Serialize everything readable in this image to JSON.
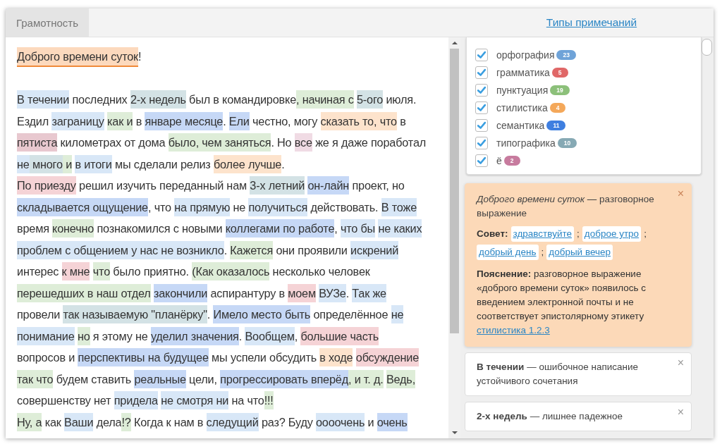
{
  "tabs": [
    {
      "label": "Грамотность",
      "selected": true
    }
  ],
  "types_link": "Типы примечаний",
  "categories": [
    {
      "label": "орфография",
      "count": "23",
      "color": "#6fa3d8",
      "checked": true
    },
    {
      "label": "грамматика",
      "count": "5",
      "color": "#e06868",
      "checked": true
    },
    {
      "label": "пунктуация",
      "count": "19",
      "color": "#8cc07a",
      "checked": true
    },
    {
      "label": "стилистика",
      "count": "4",
      "color": "#f4a85a",
      "checked": true
    },
    {
      "label": "семантика",
      "count": "11",
      "color": "#3f7fe0",
      "checked": true
    },
    {
      "label": "типографика",
      "count": "10",
      "color": "#86a9b4",
      "checked": true
    },
    {
      "label": "ё",
      "count": "2",
      "color": "#c77b9e",
      "checked": true
    }
  ],
  "lines": [
    [
      {
        "t": "Доброго времени суток",
        "color": "#fcd9bd",
        "selected": true
      },
      {
        "t": "!"
      }
    ],
    [
      {
        "t": "В течении",
        "color": "#d8e7f7",
        "selected": false
      },
      {
        "t": " последних "
      },
      {
        "t": "2-х недель",
        "color": "#d3e2e5",
        "selected": false
      },
      {
        "t": " был в командировке"
      },
      {
        "t": ", начиная с ",
        "color": "#deedd8",
        "selected": false
      },
      {
        "t": "5-ого",
        "color": "#d3e2e5",
        "selected": false
      },
      {
        "t": " июля."
      }
    ],
    [
      {
        "t": "Ездил "
      },
      {
        "t": "заграницу ",
        "color": "#d8e7f7",
        "selected": false
      },
      {
        "t": "как и",
        "color": "#deedd8",
        "selected": false
      },
      {
        "t": " в "
      },
      {
        "t": "январе месяце",
        "color": "#c6d8f6",
        "selected": false
      },
      {
        "t": ". "
      },
      {
        "t": "Ели",
        "color": "#c6d8f6",
        "selected": false
      },
      {
        "t": " честно, могу "
      },
      {
        "t": "сказать то, что",
        "color": "#fde3cc",
        "selected": false
      },
      {
        "t": " в"
      }
    ],
    [
      {
        "t": "пятиста",
        "color": "#e8c8cf",
        "selected": false
      },
      {
        "t": " километрах от дома "
      },
      {
        "t": "было, чем заняться",
        "color": "#deedd8",
        "selected": false
      },
      {
        "t": ". Но "
      },
      {
        "t": "все",
        "color": "#f0dbe4",
        "selected": false
      },
      {
        "t": " же я даже поработал"
      }
    ],
    [
      {
        "t": "не",
        "color": "#d8e7f7",
        "selected": false
      },
      {
        "t": " много",
        "color": "#d3e2e5",
        "selected": false
      },
      {
        "t": " и ",
        "color": "#deedd8",
        "selected": false
      },
      {
        "t": "в итоги",
        "color": "#d8e7f7",
        "selected": false
      },
      {
        "t": " мы сделали релиз "
      },
      {
        "t": "более лучше",
        "color": "#fde3cc",
        "selected": false
      },
      {
        "t": "."
      }
    ],
    [
      {
        "t": "По приезду",
        "color": "#f5d3d6",
        "selected": false
      },
      {
        "t": " решил изучить переданный нам "
      },
      {
        "t": "3-х летний ",
        "color": "#d3e2e5",
        "selected": false
      },
      {
        "t": "он-лайн",
        "color": "#c6d8f6",
        "selected": false
      },
      {
        "t": " проект, но"
      }
    ],
    [
      {
        "t": "складывается ощущение",
        "color": "#c6d8f6",
        "selected": false
      },
      {
        "t": ", что "
      },
      {
        "t": "на прямую",
        "color": "#d8e7f7",
        "selected": false
      },
      {
        "t": " не "
      },
      {
        "t": "получиться",
        "color": "#d8e7f7",
        "selected": false
      },
      {
        "t": " действовать. "
      },
      {
        "t": "В тоже",
        "color": "#d8e7f7",
        "selected": false
      }
    ],
    [
      {
        "t": "время "
      },
      {
        "t": "конечно",
        "color": "#deedd8",
        "selected": false
      },
      {
        "t": " познакомился с новыми "
      },
      {
        "t": "коллегами по работе",
        "color": "#c6d8f6",
        "selected": false
      },
      {
        "t": ", "
      },
      {
        "t": "что бы ",
        "color": "#d8e7f7",
        "selected": false
      },
      {
        "t": "не каких",
        "color": "#d8e7f7",
        "selected": false
      }
    ],
    [
      {
        "t": "проблем с общением у нас не возникло",
        "color": "#d8e7f7",
        "selected": false
      },
      {
        "t": ". "
      },
      {
        "t": "Кажется",
        "color": "#deedd8",
        "selected": false
      },
      {
        "t": " они проявили "
      },
      {
        "t": "искрений",
        "color": "#d8e7f7",
        "selected": false
      }
    ],
    [
      {
        "t": "интерес "
      },
      {
        "t": "к мне ",
        "color": "#f5d3d6",
        "selected": false
      },
      {
        "t": "что",
        "color": "#deedd8",
        "selected": false
      },
      {
        "t": " было приятно. "
      },
      {
        "t": "(Как оказалось",
        "color": "#deedd8",
        "selected": false
      },
      {
        "t": " несколько человек"
      }
    ],
    [
      {
        "t": "перешедших в наш отдел ",
        "color": "#deedd8",
        "selected": false
      },
      {
        "t": "закончили",
        "color": "#c6d8f6",
        "selected": false
      },
      {
        "t": " аспирантуру в "
      },
      {
        "t": "моем ",
        "color": "#f5d3d6",
        "selected": false
      },
      {
        "t": "ВУЗе",
        "color": "#d8e7f7",
        "selected": false
      },
      {
        "t": ". "
      },
      {
        "t": "Так же",
        "color": "#d8e7f7",
        "selected": false
      }
    ],
    [
      {
        "t": "провели "
      },
      {
        "t": "так называемую \"планёрку\"",
        "color": "#d3e2e5",
        "selected": false
      },
      {
        "t": ". "
      },
      {
        "t": "Имело место быть",
        "color": "#c6d8f6",
        "selected": false
      },
      {
        "t": " определённое "
      },
      {
        "t": "не",
        "color": "#d8e7f7",
        "selected": false
      }
    ],
    [
      {
        "t": "понимание ",
        "color": "#d8e7f7",
        "selected": false
      },
      {
        "t": "но",
        "color": "#deedd8",
        "selected": false
      },
      {
        "t": " я этому не "
      },
      {
        "t": "уделил значения",
        "color": "#c6d8f6",
        "selected": false
      },
      {
        "t": ". "
      },
      {
        "t": "Вообщем",
        "color": "#d8e7f7",
        "selected": false
      },
      {
        "t": ", "
      },
      {
        "t": "большие часть",
        "color": "#f5d3d6",
        "selected": false
      }
    ],
    [
      {
        "t": "вопросов и "
      },
      {
        "t": "перспективы на будущее",
        "color": "#c6d8f6",
        "selected": false
      },
      {
        "t": " мы успели обсудить "
      },
      {
        "t": "в ходе ",
        "color": "#fde3cc",
        "selected": false
      },
      {
        "t": "обсуждение",
        "color": "#f5d3d6",
        "selected": false
      }
    ],
    [
      {
        "t": "так что",
        "color": "#deedd8",
        "selected": false
      },
      {
        "t": " будем ставить "
      },
      {
        "t": "реальные",
        "color": "#c6d8f6",
        "selected": false
      },
      {
        "t": " цели, "
      },
      {
        "t": "прогрессировать вперёд",
        "color": "#c6d8f6",
        "selected": false
      },
      {
        "t": ", и т. д. ",
        "color": "#deedd8",
        "selected": false
      },
      {
        "t": "Ведь,",
        "color": "#deedd8",
        "selected": false
      }
    ],
    [
      {
        "t": "совершенству нет "
      },
      {
        "t": "придела ",
        "color": "#d8e7f7",
        "selected": false
      },
      {
        "t": "не смотря ни",
        "color": "#d8e7f7",
        "selected": false
      },
      {
        "t": " на что"
      },
      {
        "t": "!!!",
        "color": "#deedd8",
        "selected": false
      }
    ],
    [
      {
        "t": "Ну, а",
        "color": "#deedd8",
        "selected": false
      },
      {
        "t": " как "
      },
      {
        "t": "Ваши",
        "color": "#d8e7f7",
        "selected": false
      },
      {
        "t": " дела"
      },
      {
        "t": "!?",
        "color": "#deedd8",
        "selected": false
      },
      {
        "t": " Когда к нам в "
      },
      {
        "t": "следущий",
        "color": "#d8e7f7",
        "selected": false
      },
      {
        "t": " раз? Буду "
      },
      {
        "t": "оооочень",
        "color": "#d8e7f7",
        "selected": false
      },
      {
        "t": " и "
      },
      {
        "t": "очень",
        "color": "#c6d8f6",
        "selected": false
      }
    ]
  ],
  "notes": [
    {
      "selected": true,
      "close": "×",
      "title": "*Доброго времени суток —* разговорное выражение",
      "advice_label": "Совет:",
      "suggestions": [
        "здравствуйте",
        "доброе утро",
        "добрый день",
        "добрый вечер"
      ],
      "separator": ";",
      "explanation": "**Пояснение:** разговорное выражение «доброго времени суток» появилось с введением электронной почты и не соответствует эпистолярному этикету",
      "rule_link": "стилистика 1.2.3"
    },
    {
      "selected": false,
      "close": "×",
      "title": "**В течении** — ошибочное написание устойчивого сочетания"
    },
    {
      "selected": false,
      "close": "×",
      "title": "**2-х недель** — лишнее падежное"
    }
  ]
}
